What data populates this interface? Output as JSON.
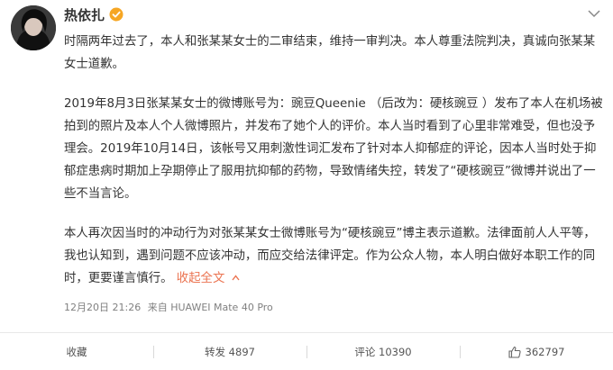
{
  "post": {
    "username": "热依扎",
    "paragraphs": [
      "时隔两年过去了，本人和张某某女士的二审结束，维持一审判决。本人尊重法院判决，真诚向张某某女士道歉。",
      "2019年8月3日张某某女士的微博账号为：豌豆Queenie （后改为：硬核豌豆 ）发布了本人在机场被拍到的照片及本人个人微博照片，并发布了她个人的评价。本人当时看到了心里非常难受，但也没予理会。2019年10月14日，该帐号又用刺激性词汇发布了针对本人抑郁症的评论，因本人当时处于抑郁症患病时期加上孕期停止了服用抗抑郁的药物，导致情绪失控，转发了“硬核豌豆”微博并说出了一些不当言论。",
      "本人再次因当时的冲动行为对张某某女士微博账号为“硬核豌豆”博主表示道歉。法律面前人人平等，我也认知到，遇到问题不应该冲动，而应交给法律评定。作为公众人物，本人明白做好本职工作的同时，更要谨言慎行。"
    ],
    "collapse_label": "收起全文",
    "timestamp": "12月20日 21:26",
    "source": "来自 HUAWEI Mate 40 Pro"
  },
  "actions": {
    "favorite": "收藏",
    "repost": "转发 4897",
    "comment": "评论 10390",
    "like": "362797"
  },
  "colors": {
    "accent": "#eb7350",
    "verified": "#f6a623"
  }
}
